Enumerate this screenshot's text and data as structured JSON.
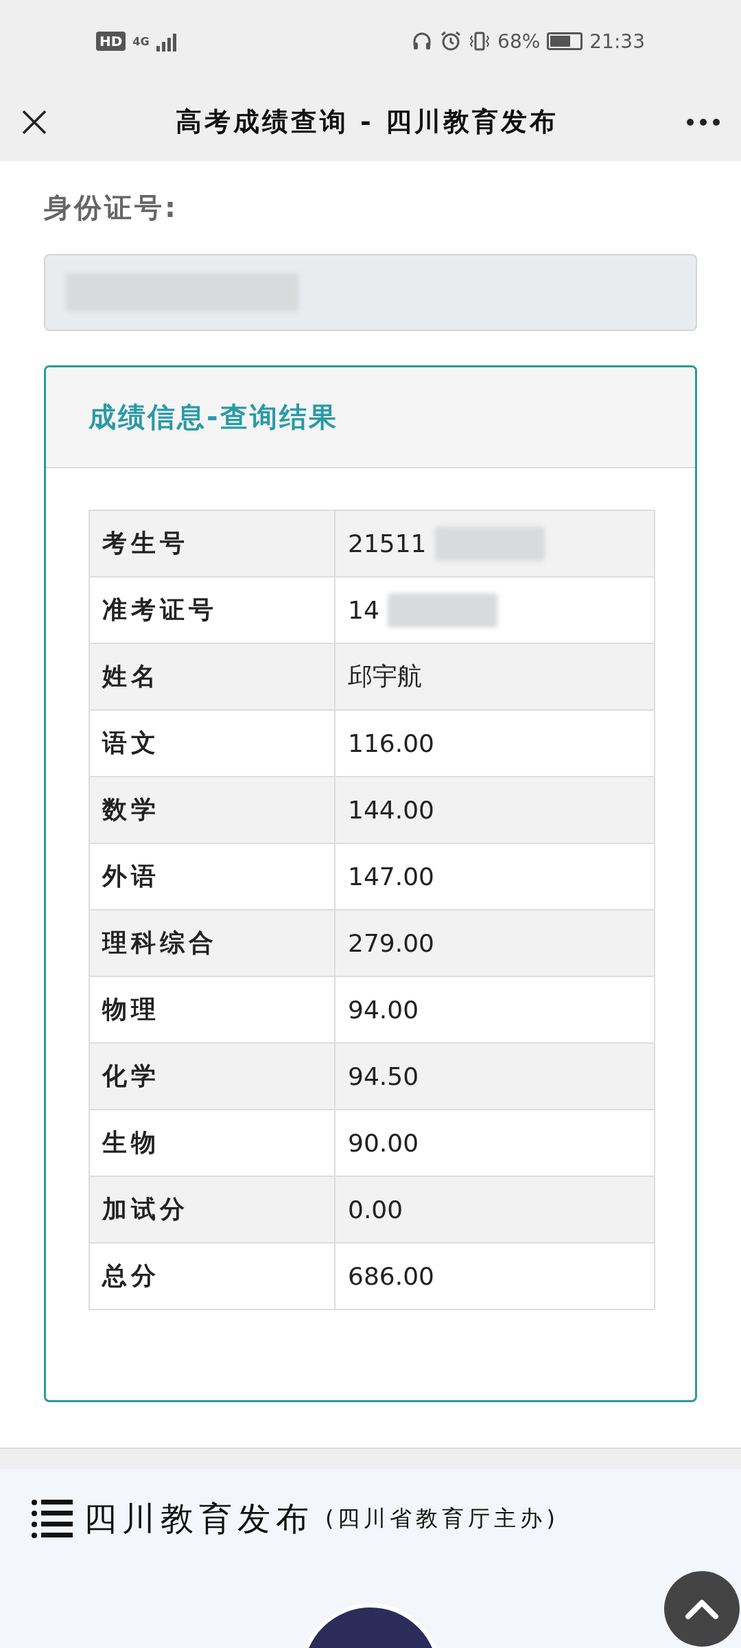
{
  "status_bar": {
    "hd": "HD",
    "network": "4G",
    "battery_percent": "68%",
    "battery": {
      "level": 0.68
    },
    "time": "21:33"
  },
  "header": {
    "title": "高考成绩查询 - 四川教育发布"
  },
  "id_field": {
    "label": "身份证号:"
  },
  "result_panel": {
    "title": "成绩信息-查询结果",
    "rows": [
      {
        "label": "考生号",
        "value": "21511",
        "redacted": true
      },
      {
        "label": "准考证号",
        "value": "14",
        "redacted": true
      },
      {
        "label": "姓名",
        "value": "邱宇航",
        "redacted": false
      },
      {
        "label": "语文",
        "value": "116.00",
        "redacted": false
      },
      {
        "label": "数学",
        "value": "144.00",
        "redacted": false
      },
      {
        "label": "外语",
        "value": "147.00",
        "redacted": false
      },
      {
        "label": "理科综合",
        "value": "279.00",
        "redacted": false
      },
      {
        "label": "物理",
        "value": "94.00",
        "redacted": false
      },
      {
        "label": "化学",
        "value": "94.50",
        "redacted": false
      },
      {
        "label": "生物",
        "value": "90.00",
        "redacted": false
      },
      {
        "label": "加试分",
        "value": "0.00",
        "redacted": false
      },
      {
        "label": "总分",
        "value": "686.00",
        "redacted": false
      }
    ]
  },
  "footer": {
    "title": "四川教育发布",
    "subtitle": "(四川省教育厅主办)"
  }
}
